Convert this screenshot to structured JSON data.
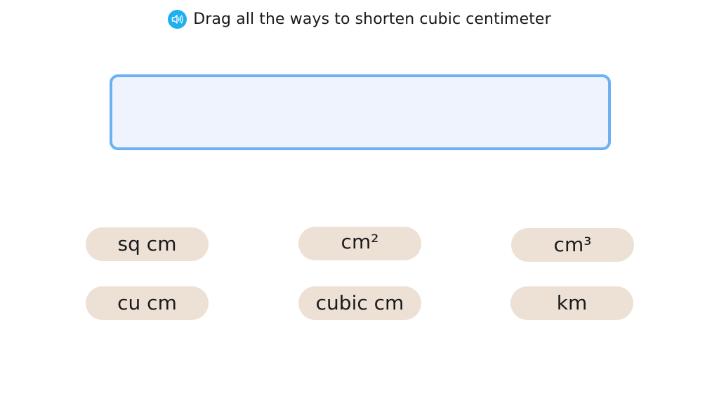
{
  "prompt": {
    "text": "Drag all the ways to shorten cubic centimeter",
    "audio_icon": "speaker-icon",
    "audio_color": "#1fb0ef"
  },
  "drop_zone": {
    "items": [],
    "border_color": "#6db1f2",
    "fill_color": "#eff3fe"
  },
  "tiles": [
    {
      "label": "sq cm"
    },
    {
      "label": "cm²"
    },
    {
      "label": "cm³"
    },
    {
      "label": "cu cm"
    },
    {
      "label": "cubic cm"
    },
    {
      "label": "km"
    }
  ],
  "tile_color": "#ede1d6"
}
